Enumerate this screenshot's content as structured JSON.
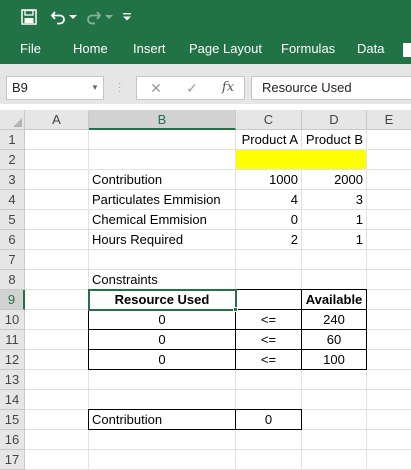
{
  "ribbon": {
    "tabs": [
      "File",
      "Home",
      "Insert",
      "Page Layout",
      "Formulas",
      "Data"
    ],
    "quick_access": [
      "save-icon",
      "undo-icon",
      "undo-dropdown-icon",
      "redo-icon",
      "redo-dropdown-icon",
      "customize-toolbar-icon"
    ],
    "color": "#217346"
  },
  "formula_bar": {
    "name_box": "B9",
    "cancel_glyph": "✕",
    "enter_glyph": "✓",
    "fx_glyph": "fx",
    "content": "Resource Used"
  },
  "sheet": {
    "columns": [
      "A",
      "B",
      "C",
      "D",
      "E"
    ],
    "rows": [
      "1",
      "2",
      "3",
      "4",
      "5",
      "6",
      "7",
      "8",
      "9",
      "10",
      "11",
      "12",
      "13",
      "14",
      "15",
      "16",
      "17"
    ],
    "selected_column": "B",
    "selected_row": "9",
    "header_product_a": "Product A",
    "header_product_b": "Product B",
    "highlight_color": "#ffff00",
    "items": [
      {
        "label": "Contribution",
        "a": "1000",
        "b": "2000"
      },
      {
        "label": "Particulates Emmision",
        "a": "4",
        "b": "3"
      },
      {
        "label": "Chemical Emmision",
        "a": "0",
        "b": "1"
      },
      {
        "label": "Hours Required",
        "a": "2",
        "b": "1"
      }
    ],
    "constraints_title": "Constraints",
    "constraints_header": {
      "used": "Resource Used",
      "available": "Available"
    },
    "constraints": [
      {
        "used": "0",
        "op": "<=",
        "available": "240"
      },
      {
        "used": "0",
        "op": "<=",
        "available": "60"
      },
      {
        "used": "0",
        "op": "<=",
        "available": "100"
      }
    ],
    "total_label": "Contribution",
    "total_value": "0"
  }
}
